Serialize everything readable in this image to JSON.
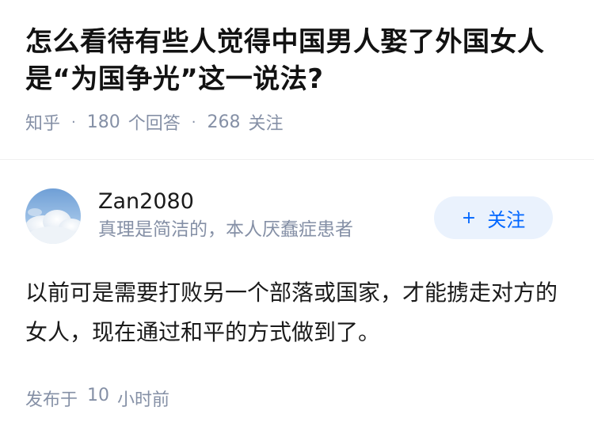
{
  "question": {
    "title": "怎么看待有些人觉得中国男人娶了外国女人是“为国争光”这一说法?",
    "source": "知乎",
    "answer_count": "180",
    "answer_label": "个回答",
    "follower_count": "268",
    "follower_label": "关注"
  },
  "answer": {
    "author": {
      "name": "Zan2080",
      "bio": "真理是简洁的，本人厌蠢症患者",
      "avatar_icon": "sky-clouds-avatar"
    },
    "follow_button": {
      "icon": "plus-icon",
      "label": "关注"
    },
    "content": "以前可是需要打败另一个部落或国家，才能掳走对方的女人，现在通过和平的方式做到了。",
    "posted_prefix": "发布于",
    "posted_value": "10",
    "posted_unit": "小时前"
  },
  "colors": {
    "accent": "#0066ff",
    "follow_bg": "#eaf2fd",
    "meta_text": "#8590a6"
  }
}
